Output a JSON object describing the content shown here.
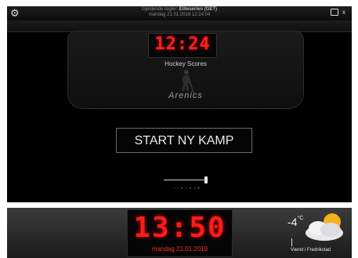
{
  "topbar": {
    "rules_label": "Gjeldende regler:",
    "rules_value": "Eliteserien (GET)",
    "datetime": "mandag  21.01.2019  12:24:04",
    "close_label": "x"
  },
  "scoreboard": {
    "clock": "12:24",
    "title": "Hockey Scores",
    "logo": "Arenics"
  },
  "start_button": {
    "label": "START NY KAMP"
  },
  "slider": {
    "caption": "• / ✕ / ✕ | ✕",
    "value_fraction": 0.96
  },
  "bottom": {
    "clock": "13:50",
    "date": "mandag  21.01.2019",
    "temperature": "-4",
    "temperature_unit": "°C",
    "weather_caption": "Været i Fredrikstad"
  },
  "colors": {
    "clock_red": "#ff1f1f",
    "background": "#000000",
    "bottom_bar": "#2b2b2b"
  },
  "icons": {
    "settings": "gear-icon",
    "display": "monitor-icon",
    "weather": "partly-cloudy-icon"
  }
}
